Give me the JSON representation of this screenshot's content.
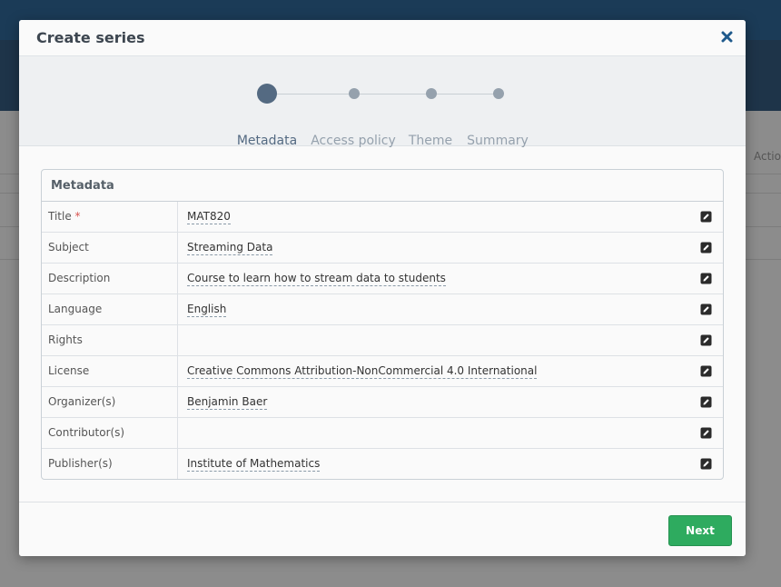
{
  "background": {
    "actions_label": "Actio"
  },
  "modal": {
    "title": "Create series",
    "close_icon": "close-icon",
    "steps": [
      {
        "label": "Metadata",
        "active": true
      },
      {
        "label": "Access policy",
        "active": false
      },
      {
        "label": "Theme",
        "active": false
      },
      {
        "label": "Summary",
        "active": false
      }
    ],
    "panel": {
      "heading": "Metadata",
      "rows": [
        {
          "label": "Title",
          "required": "*",
          "value": "MAT820"
        },
        {
          "label": "Subject",
          "required": "",
          "value": "Streaming Data"
        },
        {
          "label": "Description",
          "required": "",
          "value": "Course to learn how to stream data to students"
        },
        {
          "label": "Language",
          "required": "",
          "value": "English"
        },
        {
          "label": "Rights",
          "required": "",
          "value": ""
        },
        {
          "label": "License",
          "required": "",
          "value": "Creative Commons Attribution-NonCommercial 4.0 International"
        },
        {
          "label": "Organizer(s)",
          "required": "",
          "value": "Benjamin Baer"
        },
        {
          "label": "Contributor(s)",
          "required": "",
          "value": ""
        },
        {
          "label": "Publisher(s)",
          "required": "",
          "value": "Institute of Mathematics"
        }
      ]
    },
    "footer": {
      "next_label": "Next"
    }
  },
  "colors": {
    "accent_active_step": "#546a82",
    "inactive_step": "#95a1ad",
    "next_button": "#2eab5f",
    "close_icon": "#1f5a8c",
    "required": "#d9534f"
  }
}
